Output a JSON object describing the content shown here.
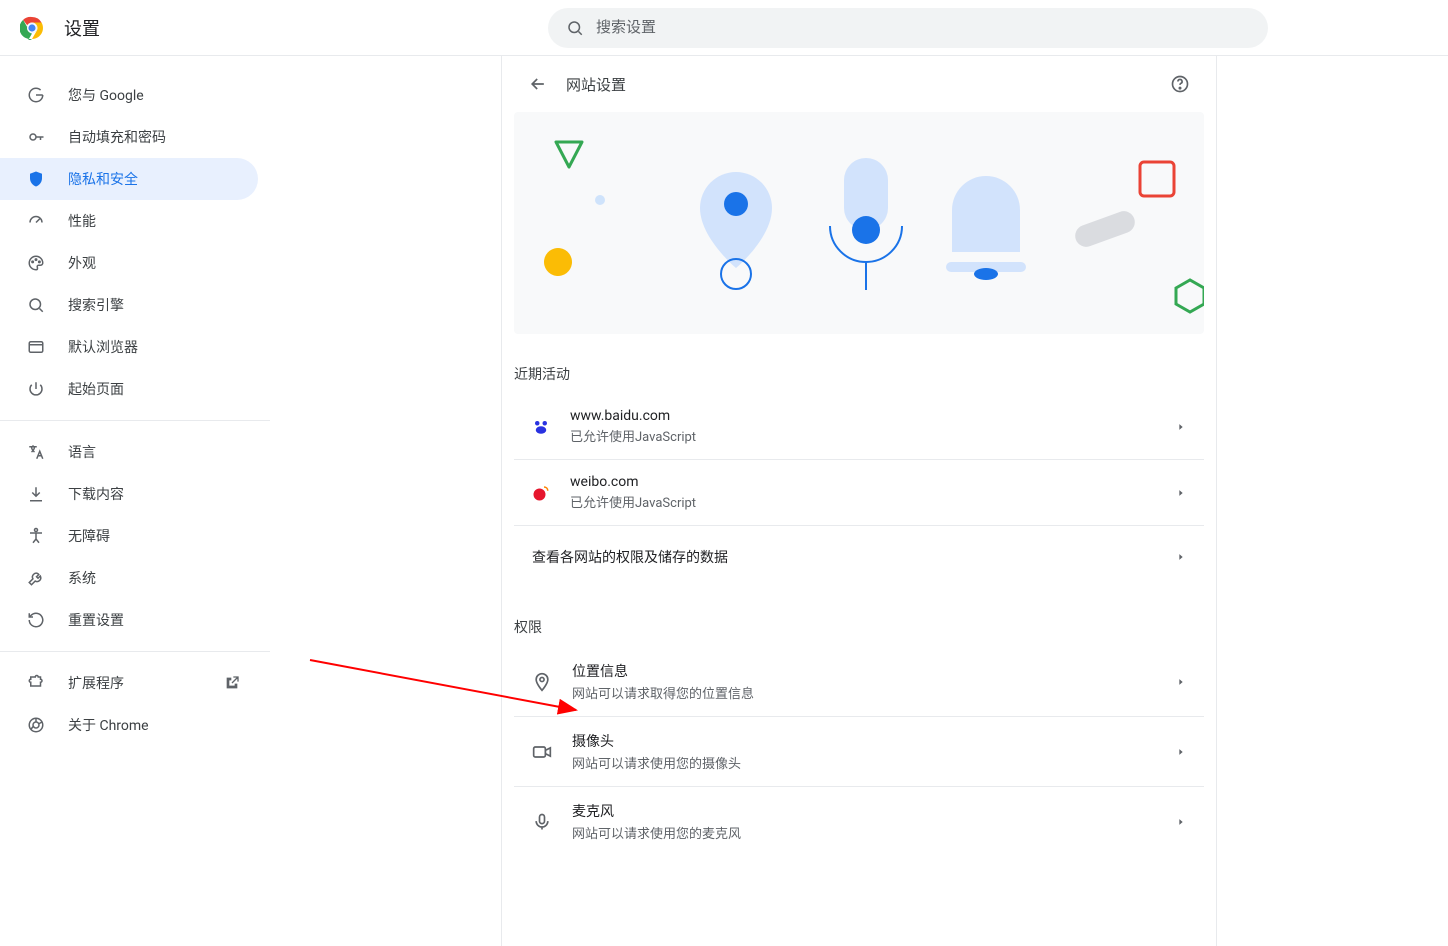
{
  "header": {
    "title": "设置",
    "search_placeholder": "搜索设置"
  },
  "sidebar": {
    "items": [
      {
        "id": "you-and-google",
        "label": "您与 Google",
        "icon": "google-g"
      },
      {
        "id": "autofill",
        "label": "自动填充和密码",
        "icon": "key"
      },
      {
        "id": "privacy",
        "label": "隐私和安全",
        "icon": "shield",
        "active": true
      },
      {
        "id": "performance",
        "label": "性能",
        "icon": "speedometer"
      },
      {
        "id": "appearance",
        "label": "外观",
        "icon": "palette"
      },
      {
        "id": "search-engine",
        "label": "搜索引擎",
        "icon": "search"
      },
      {
        "id": "default-browser",
        "label": "默认浏览器",
        "icon": "browser"
      },
      {
        "id": "startup",
        "label": "起始页面",
        "icon": "power"
      }
    ],
    "advanced_items": [
      {
        "id": "languages",
        "label": "语言",
        "icon": "translate"
      },
      {
        "id": "downloads",
        "label": "下载内容",
        "icon": "download"
      },
      {
        "id": "accessibility",
        "label": "无障碍",
        "icon": "accessibility"
      },
      {
        "id": "system",
        "label": "系统",
        "icon": "wrench"
      },
      {
        "id": "reset",
        "label": "重置设置",
        "icon": "reset"
      }
    ],
    "footer_items": [
      {
        "id": "extensions",
        "label": "扩展程序",
        "icon": "extension",
        "external": true
      },
      {
        "id": "about",
        "label": "关于 Chrome",
        "icon": "chrome-outline"
      }
    ]
  },
  "content": {
    "page_title": "网站设置",
    "recent_section_label": "近期活动",
    "recent": [
      {
        "site": "www.baidu.com",
        "detail": "已允许使用JavaScript",
        "favicon": "baidu"
      },
      {
        "site": "weibo.com",
        "detail": "已允许使用JavaScript",
        "favicon": "weibo"
      }
    ],
    "view_all_label": "查看各网站的权限及储存的数据",
    "permissions_section_label": "权限",
    "permissions": [
      {
        "id": "location",
        "title": "位置信息",
        "subtitle": "网站可以请求取得您的位置信息",
        "icon": "location"
      },
      {
        "id": "camera",
        "title": "摄像头",
        "subtitle": "网站可以请求使用您的摄像头",
        "icon": "camera"
      },
      {
        "id": "microphone",
        "title": "麦克风",
        "subtitle": "网站可以请求使用您的麦克风",
        "icon": "mic"
      }
    ]
  }
}
